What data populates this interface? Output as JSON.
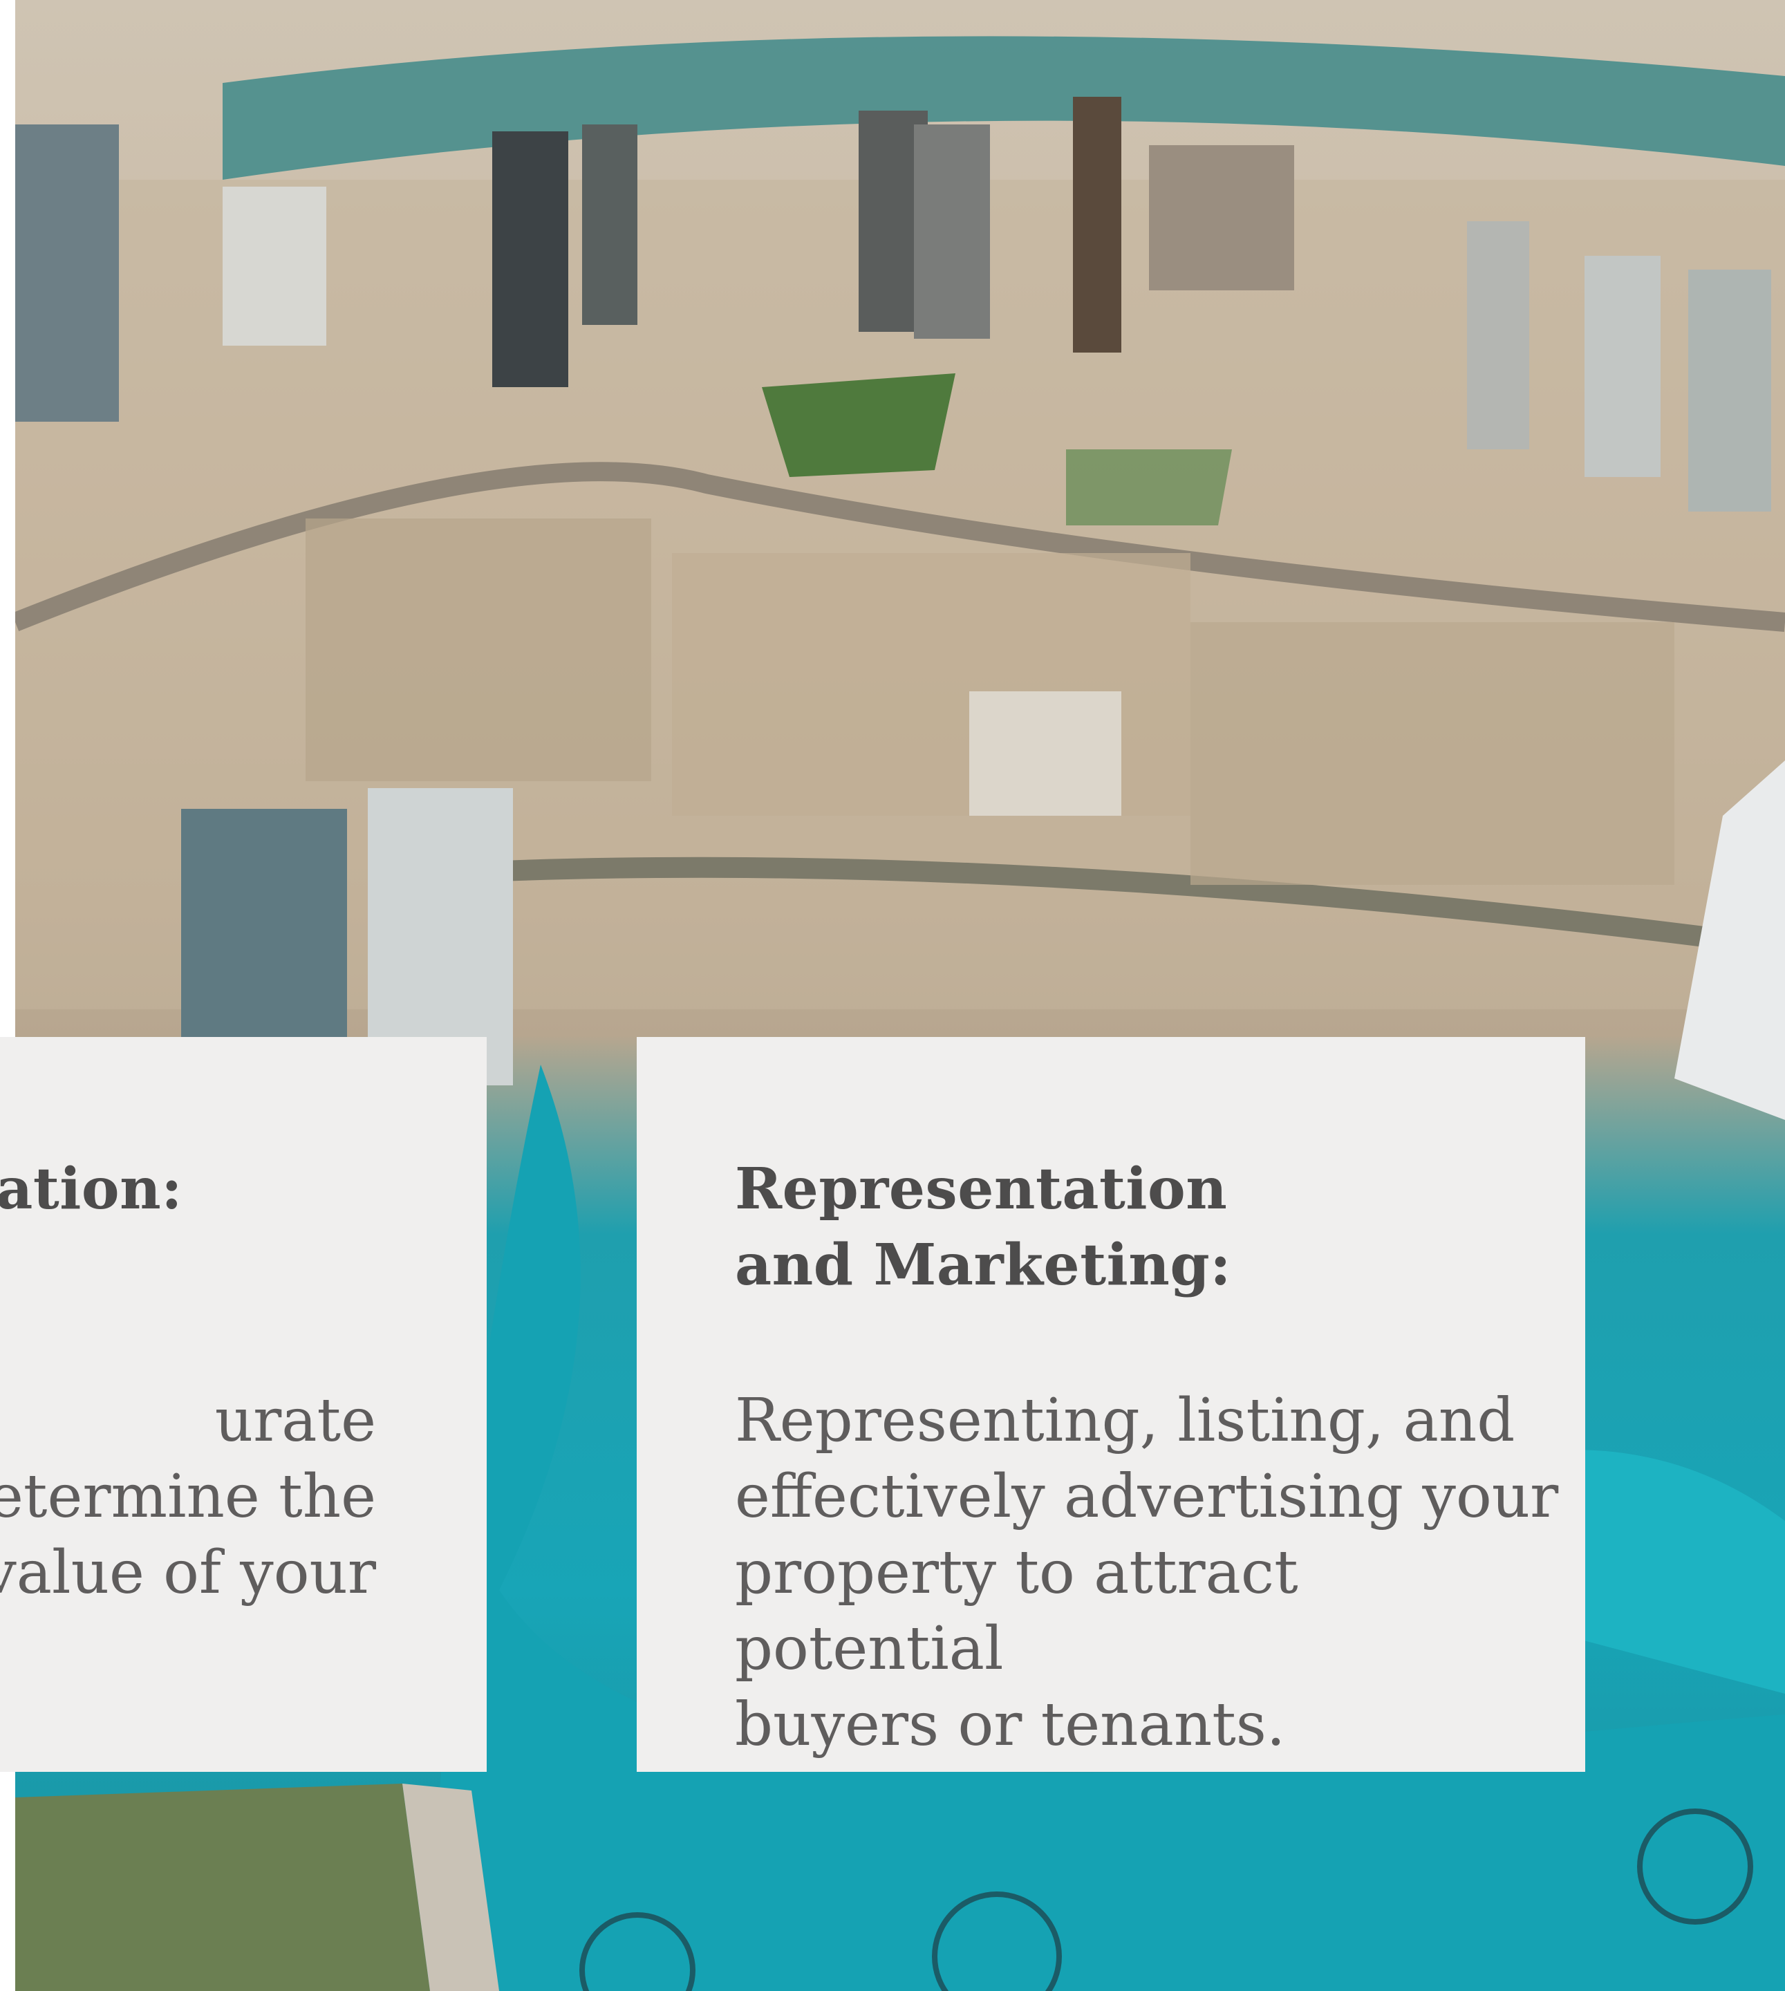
{
  "cards": [
    {
      "id": "valuation",
      "title": "uation:",
      "body": "urate\ndetermine the\nl value of your"
    },
    {
      "id": "representation-marketing",
      "title": "Representation\nand Marketing:",
      "body": "Representing, listing, and\neffectively advertising your\nproperty to attract potential\nbuyers or tenants."
    }
  ],
  "colors": {
    "card_background": "#f0efee",
    "title_text": "#4d4c4c",
    "body_text": "#5f5d5d",
    "water": "#18a5b7"
  }
}
